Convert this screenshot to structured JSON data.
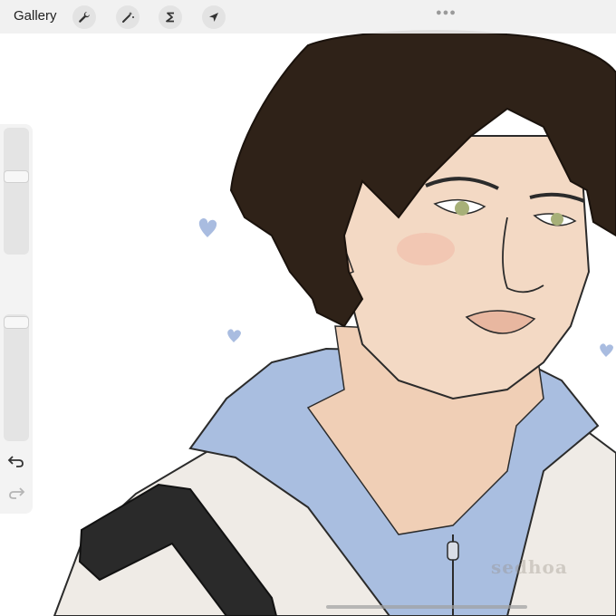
{
  "toolbar": {
    "gallery_label": "Gallery",
    "tools": [
      {
        "name": "actions",
        "icon": "wrench-icon"
      },
      {
        "name": "adjustments",
        "icon": "magic-wand-icon"
      },
      {
        "name": "selection",
        "icon": "selection-s-icon"
      },
      {
        "name": "transform",
        "icon": "arrow-cursor-icon"
      }
    ]
  },
  "sidebar": {
    "brush_size_icon": "slider",
    "opacity_icon": "slider",
    "modify_icon": "square-icon",
    "undo_icon": "undo-icon",
    "redo_icon": "redo-icon"
  },
  "artwork": {
    "watermark": "sedhoa"
  },
  "colors": {
    "hair": "#2f2218",
    "skin": "#f3d9c4",
    "hoodie": "#a9bee0",
    "jacket": "#efebe6",
    "strap": "#2a2a2a",
    "hearts": "#a9bce0"
  }
}
